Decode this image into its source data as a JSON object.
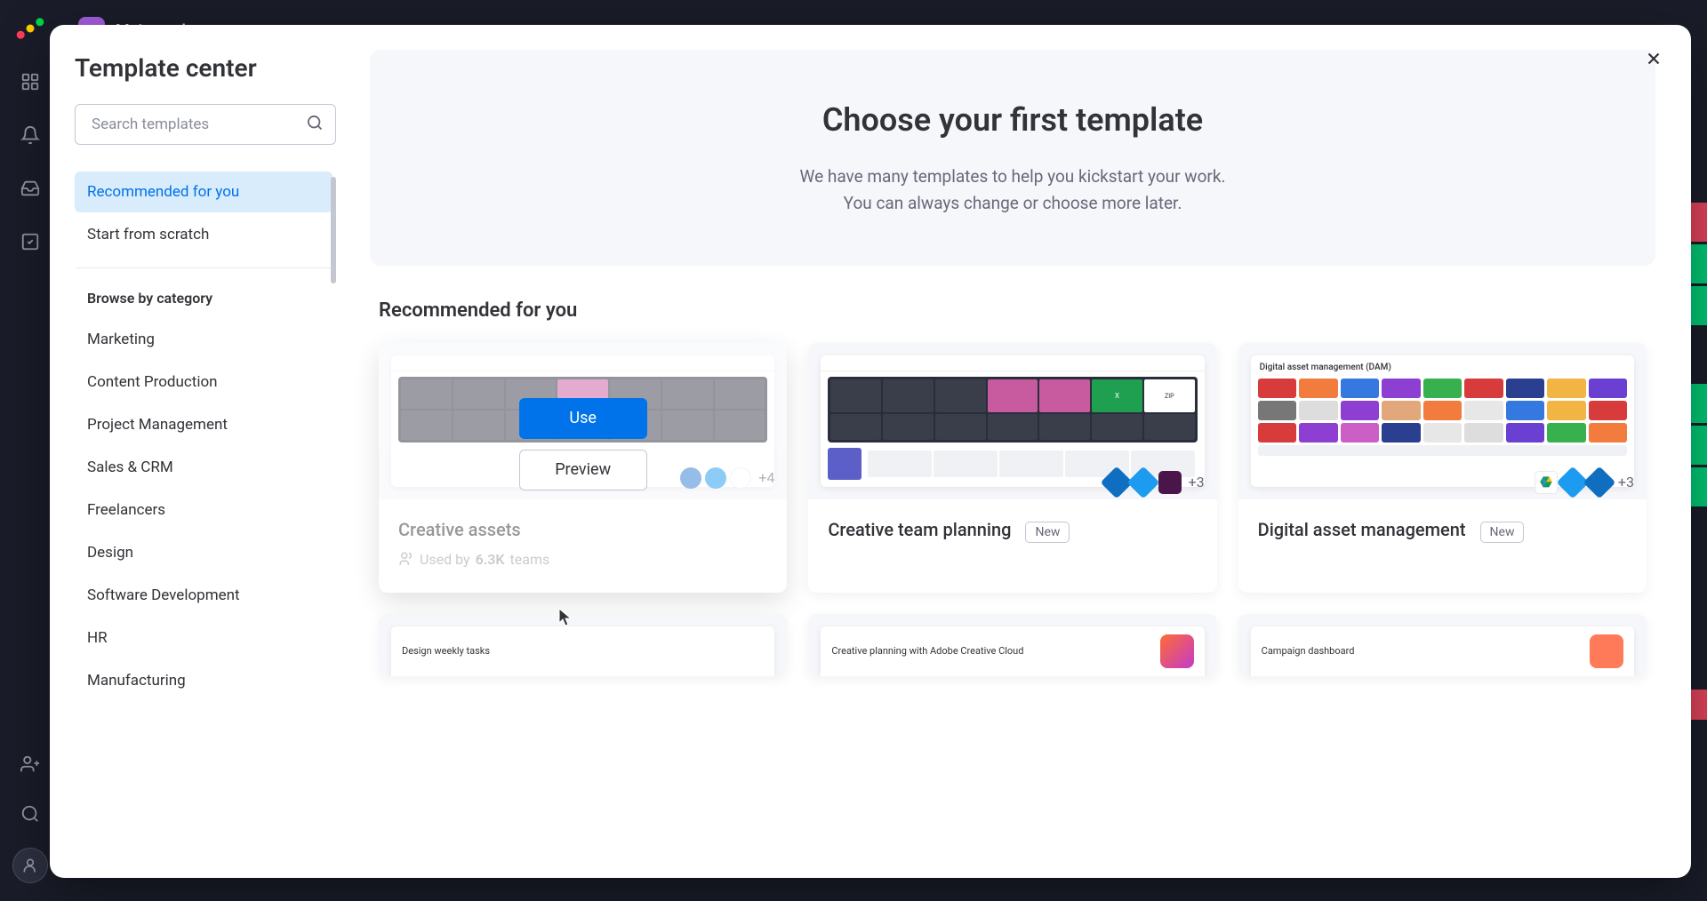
{
  "workspace": {
    "initial": "M",
    "name": "Main workspace"
  },
  "modal": {
    "title": "Template center",
    "search_placeholder": "Search templates",
    "hero_title": "Choose your first template",
    "hero_sub_line1": "We have many templates to help you kickstart your work.",
    "hero_sub_line2": "You can always change or choose more later.",
    "section_title": "Recommended for you"
  },
  "categories": {
    "recommended": "Recommended for you",
    "scratch": "Start from scratch",
    "browse_heading": "Browse by category",
    "items": [
      "Marketing",
      "Content Production",
      "Project Management",
      "Sales & CRM",
      "Freelancers",
      "Design",
      "Software Development",
      "HR",
      "Manufacturing"
    ]
  },
  "buttons": {
    "use": "Use",
    "preview": "Preview"
  },
  "cards": [
    {
      "name": "Creative assets",
      "used_prefix": "Used by",
      "used_count": "6.3K",
      "used_suffix": "teams",
      "more": "+4"
    },
    {
      "name": "Creative team planning",
      "badge": "New",
      "more": "+3"
    },
    {
      "name": "Digital asset management",
      "badge": "New",
      "thumb_title": "Digital asset management (DAM)",
      "more": "+3"
    }
  ],
  "bottom_cards": [
    {
      "mini_title": "Design weekly tasks"
    },
    {
      "mini_title": "Creative planning with Adobe Creative Cloud"
    },
    {
      "mini_title": "Campaign dashboard"
    }
  ]
}
